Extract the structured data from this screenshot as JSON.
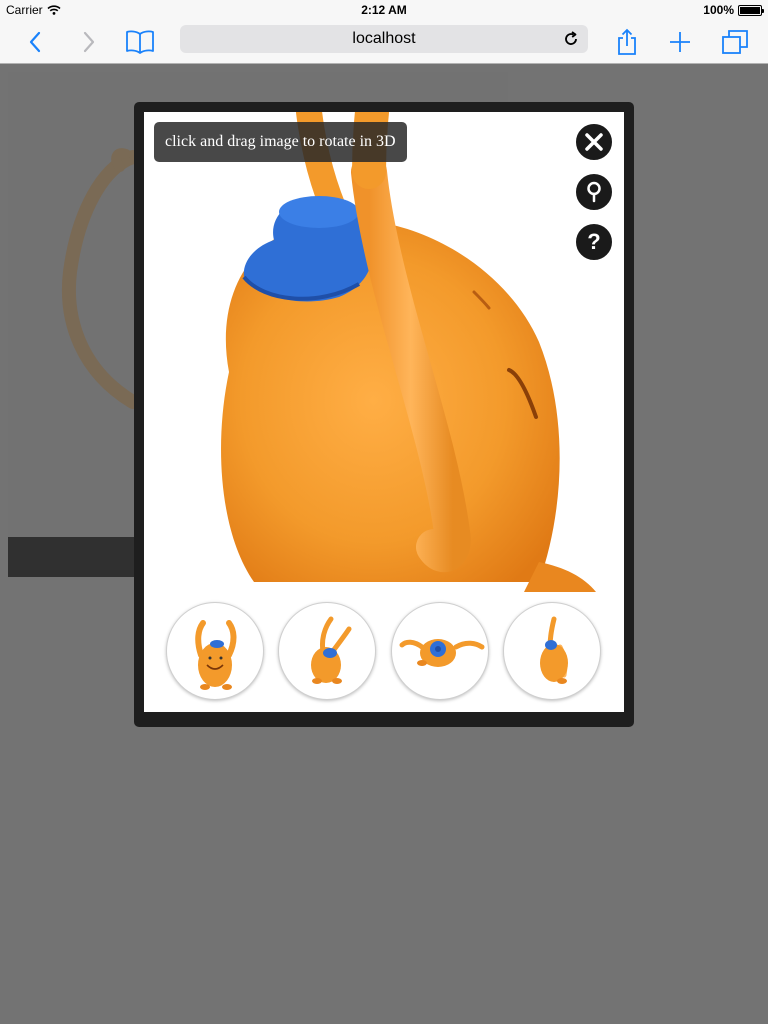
{
  "status_bar": {
    "carrier": "Carrier",
    "time": "2:12 AM",
    "battery": "100%"
  },
  "toolbar": {
    "url": "localhost",
    "icons": [
      "back-icon",
      "forward-icon",
      "bookmarks-icon",
      "reload-icon",
      "share-icon",
      "add-icon",
      "tabs-icon"
    ]
  },
  "viewer": {
    "hint": "click and drag image to rotate in 3D",
    "controls": [
      "close-icon",
      "zoom-icon",
      "help-icon"
    ],
    "help_glyph": "?",
    "thumbnails": [
      {
        "label": "front view"
      },
      {
        "label": "back view"
      },
      {
        "label": "top view"
      },
      {
        "label": "side view"
      }
    ]
  },
  "colors": {
    "overlay": "#737373",
    "modal_frame": "#1e1e1e",
    "toy_orange": "#f39a2b",
    "hat_blue": "#2f6fd6",
    "ios_blue": "#1a82fb"
  }
}
